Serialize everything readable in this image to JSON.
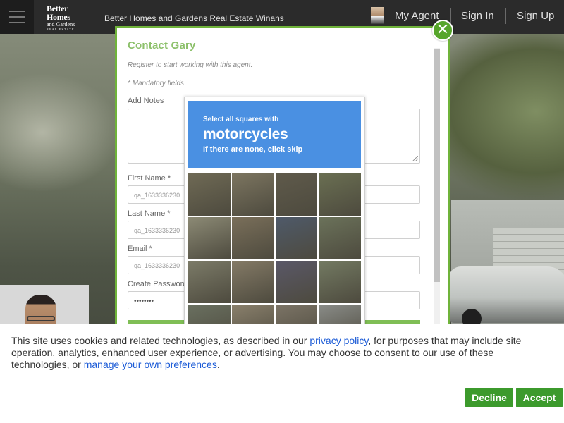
{
  "header": {
    "logo": {
      "line1": "Better Homes",
      "line2": "and Gardens",
      "line3": "REAL ESTATE"
    },
    "brand_text": "Better Homes and Gardens Real Estate Winans",
    "nav": {
      "my_agent": "My Agent",
      "sign_in": "Sign In",
      "sign_up": "Sign Up"
    }
  },
  "modal": {
    "title": "Contact Gary",
    "subtitle": "Register to start working with this agent.",
    "mandatory_note": "* Mandatory fields",
    "add_notes_label": "Add Notes",
    "first_name_label": "First Name *",
    "first_name_value": "qa_1633336230",
    "last_name_label": "Last Name *",
    "last_name_value": "qa_1633336230",
    "email_label": "Email *",
    "email_value": "qa_1633336230",
    "password_label": "Create Password",
    "password_value": "••••••••",
    "close_symbol": "✕"
  },
  "captcha": {
    "instruction": "Select all squares with",
    "target": "motorcycles",
    "skip_hint": "If there are none, click skip",
    "tiles": [
      "#6f6a55",
      "#7c7560",
      "#5f5a4b",
      "#6a6f52",
      "#8c8a75",
      "#7a6f5a",
      "#4f5a6a",
      "#6b725a",
      "#7c7b68",
      "#847a66",
      "#5a5868",
      "#737a62",
      "#6a7060",
      "#8a806c",
      "#7c7466",
      "#8a8c88"
    ]
  },
  "cookie_banner": {
    "text_before_policy": "This site uses cookies and related technologies, as described in our ",
    "privacy_link": "privacy policy",
    "text_middle": ", for purposes that may include site operation, analytics, enhanced user experience, or advertising. You may choose to consent to our use of these technologies, or ",
    "preferences_link": "manage your own preferences",
    "text_after": ".",
    "decline_label": "Decline",
    "accept_label": "Accept",
    "button_color": "#3c9a2c"
  }
}
